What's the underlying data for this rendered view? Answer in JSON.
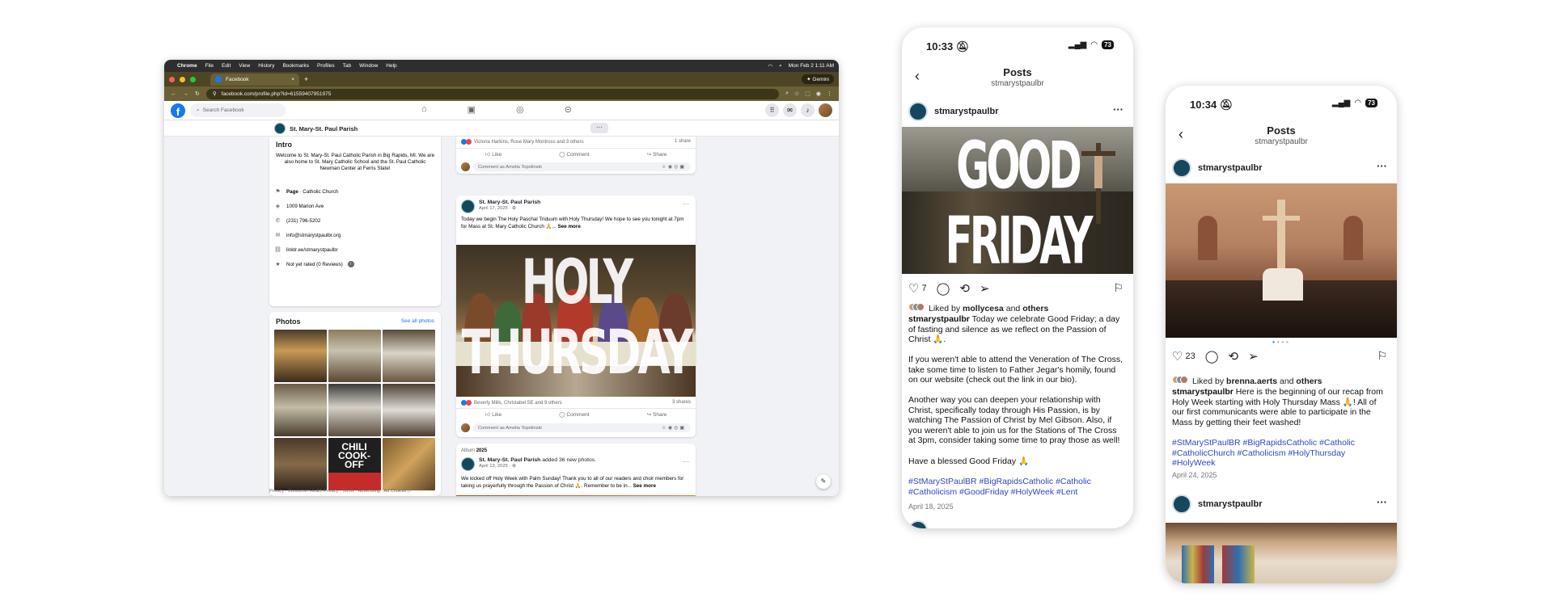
{
  "browser": {
    "menu": [
      "Chrome",
      "File",
      "Edit",
      "View",
      "History",
      "Bookmarks",
      "Profiles",
      "Tab",
      "Window",
      "Help"
    ],
    "clock": "Mon Feb 2  1:11 AM",
    "tab_title": "Facebook",
    "url": "facebook.com/profile.php?id=61559407951975",
    "gemini_label": "Gemini"
  },
  "facebook": {
    "search_placeholder": "Search Facebook",
    "page_name": "St. Mary-St. Paul Parish",
    "intro": {
      "title": "Intro",
      "bio": "Welcome to St. Mary-St. Paul Catholic Parish in Big Rapids, MI. We are also home to St. Mary Catholic School and the St. Paul Catholic Newman Center at Ferris State!",
      "category_label": "Page",
      "category": " · Catholic Church",
      "address": "1009 Marion Ave",
      "phone": "(231) 796-5202",
      "email": "info@stmarystpaulbr.org",
      "link": "linktr.ee/stmarystpaulbr",
      "rating": "Not yet rated (0 Reviews)"
    },
    "photos": {
      "title": "Photos",
      "see_all": "See all photos",
      "chili_text": "CHILI COOK-OFF"
    },
    "footer": "Privacy · Consumer Health Privacy · Terms · Advertising · Ad Choices ▷",
    "comment_placeholder": "Comment as Amelia Topolinski",
    "action_like": "Like",
    "action_comment": "Comment",
    "action_share": "Share",
    "posts": [
      {
        "reactions": "Victoria Harkins, Rose Mary Montross and 3 others",
        "shares": "1 share"
      },
      {
        "author": "St. Mary-St. Paul Parish",
        "date": "April 17, 2025 · ",
        "text": "Today we begin The Holy Paschal Triduum with Holy Thursday! We hope to see you tonight at 7pm for Mass at St. Mary Catholic Church 🙏...",
        "see_more": "See more",
        "image_text": "HOLY THURSDAY",
        "reactions": "Beverly Mills, Christabel SE and 9 others",
        "shares": "3 shares"
      },
      {
        "album_label": "Album",
        "album_year": "2025",
        "author": "St. Mary-St. Paul Parish",
        "author_suffix": " added 36 new photos.",
        "date": "April 13, 2025 · ",
        "text": "We kicked off Holy Week with Palm Sunday! Thank you to all of our readers and choir members for taking us prayerfully through the Passion of Christ 🙏. Remember to be in... ",
        "see_more": "See more"
      }
    ]
  },
  "ig1": {
    "time": "10:33",
    "battery": "73",
    "title": "Posts",
    "subtitle": "stmarystpaulbr",
    "username": "stmarystpaulbr",
    "image_text": "GOOD FRIDAY",
    "likes": "7",
    "liked_prefix": "Liked by ",
    "liked_user": "mollycesa",
    "liked_suffix": " and ",
    "liked_others": "others",
    "caption_user": "stmarystpaulbr",
    "caption_p1": " Today we celebrate Good Friday; a day of fasting and silence as we reflect on the Passion of Christ 🙏.",
    "caption_p2": "If you weren't able to attend the Veneration of The Cross, take some time to listen to Father Jegar's homily, found on our website (check out the link in our bio).",
    "caption_p3": "Another way you can deepen your relationship with Christ, specifically today through His Passion, is by watching The Passion of Christ by Mel Gibson. Also, if you weren't able to join us for the Stations of The Cross at 3pm, consider taking some time to pray those as well!",
    "caption_p4": "Have a blessed Good Friday 🙏",
    "hashtags": "#StMaryStPaulBR #BigRapidsCatholic #Catholic #Catholicism #GoodFriday #HolyWeek #Lent",
    "date": "April 18, 2025"
  },
  "ig2": {
    "time": "10:34",
    "battery": "73",
    "title": "Posts",
    "subtitle": "stmarystpaulbr",
    "username": "stmarystpaulbr",
    "likes": "23",
    "liked_prefix": "Liked by ",
    "liked_user": "brenna.aerts",
    "liked_suffix": " and ",
    "liked_others": "others",
    "caption_user": "stmarystpaulbr",
    "caption": " Here is the beginning of our recap from Holy Week starting with Holy Thursday Mass 🙏! All of our first communicants were able to participate in the Mass by getting their feet washed!",
    "hashtags": "#StMaryStPaulBR #BigRapidsCatholic #Catholic #CatholicChurch #Catholicism #HolyThursday #HolyWeek",
    "date": "April 24, 2025",
    "next_username": "stmarystpaulbr"
  },
  "colors": {
    "facebook_blue": "#1877f2",
    "instagram_link": "#3046c4",
    "chrome_frame": "#4d4523"
  }
}
